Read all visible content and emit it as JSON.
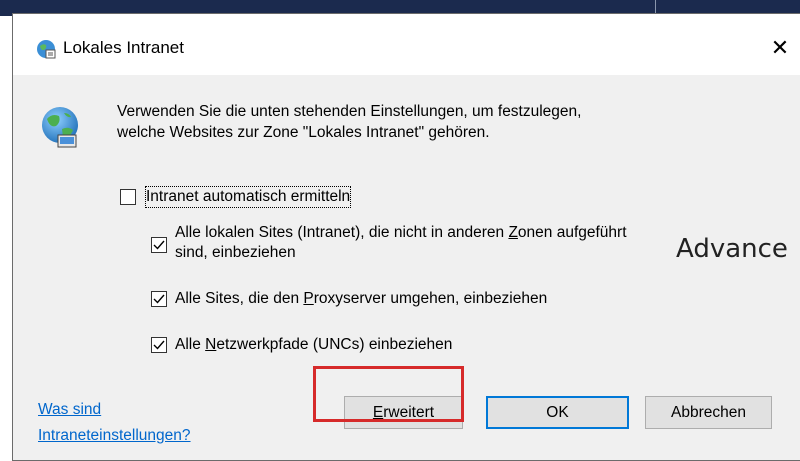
{
  "dialog": {
    "title": "Lokales Intranet",
    "close_glyph": "✕",
    "description_line1": "Verwenden Sie die unten stehenden Einstellungen, um festzulegen,",
    "description_line2": "welche Websites zur Zone \"Lokales Intranet\" gehören.",
    "auto_detect": {
      "label": "Intranet automatisch ermitteln",
      "checked": false
    },
    "options": [
      {
        "label_before": "Alle lokalen Sites (Intranet), die nicht in anderen ",
        "accel": "Z",
        "label_after": "onen aufgeführt",
        "label_line2": "sind, einbeziehen",
        "checked": true
      },
      {
        "label_before": "Alle Sites, die den ",
        "accel": "P",
        "label_after": "roxyserver umgehen, einbeziehen",
        "checked": true
      },
      {
        "label_before": "Alle ",
        "accel": "N",
        "label_after": "etzwerkpfade (UNCs) einbeziehen",
        "checked": true
      }
    ],
    "help_link_line1": "Was sind",
    "help_link_line2": "Intraneteinstellungen?",
    "buttons": {
      "advanced_accel": "E",
      "advanced_rest": "rweitert",
      "ok": "OK",
      "cancel": "Abbrechen"
    }
  },
  "background": {
    "overlay_text": "Advance"
  },
  "colors": {
    "highlight": "#d62a2a",
    "link": "#0066cc",
    "default_button_border": "#0078d7",
    "dialog_bg": "#f0f0f0"
  },
  "icons": [
    "globe-icon",
    "close-icon",
    "checkbox-check-icon"
  ]
}
